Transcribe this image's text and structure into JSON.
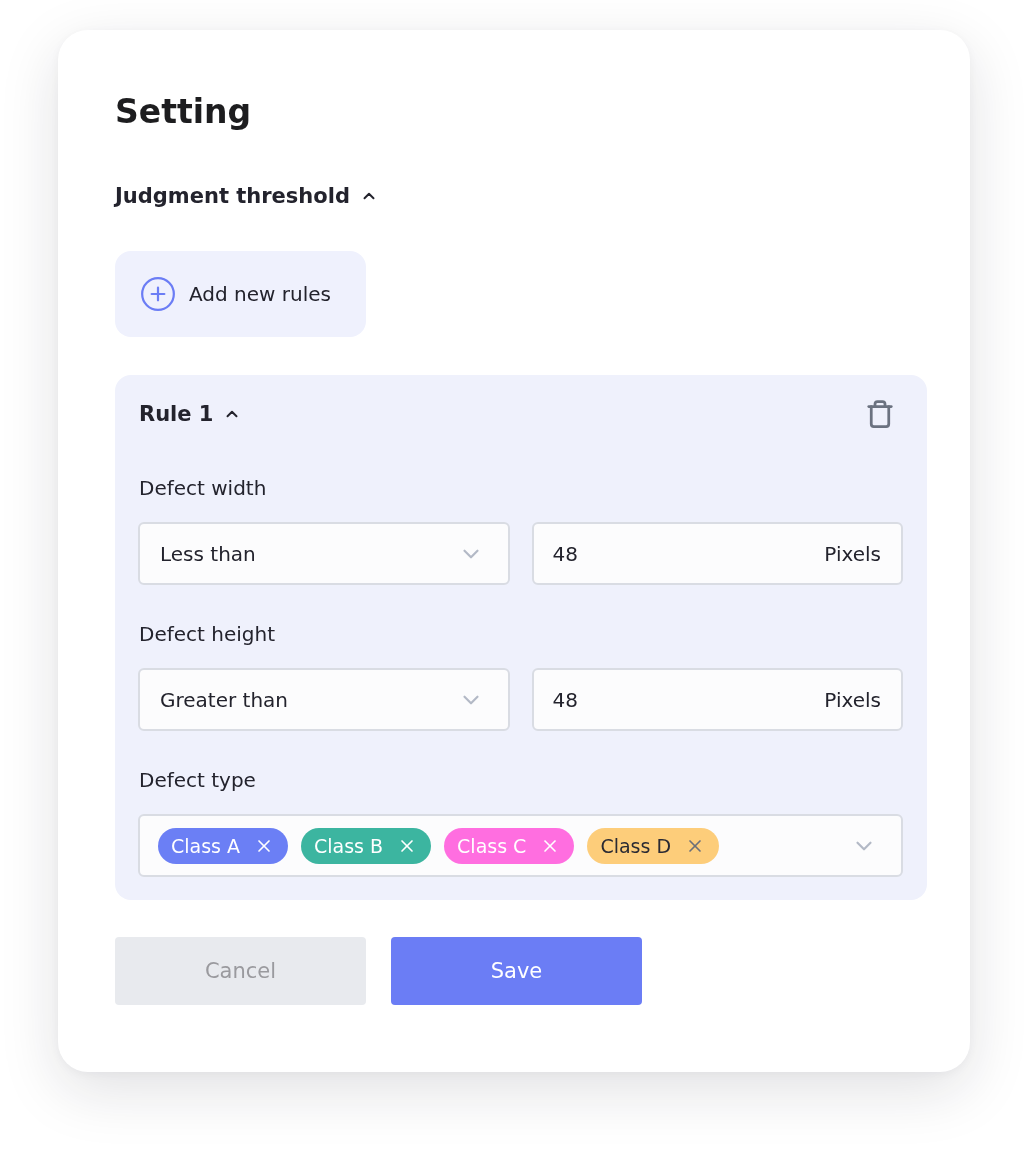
{
  "title": "Setting",
  "section": {
    "title": "Judgment threshold",
    "expanded": true
  },
  "add_button": {
    "label": "Add new rules"
  },
  "rules": [
    {
      "title": "Rule 1",
      "expanded": true,
      "fields": [
        {
          "kind": "range",
          "label": "Defect width",
          "comparison": "Less than",
          "value": "48",
          "unit": "Pixels"
        },
        {
          "kind": "range",
          "label": "Defect height",
          "comparison": "Greater than",
          "value": "48",
          "unit": "Pixels"
        },
        {
          "kind": "tags",
          "label": "Defect type",
          "tags": [
            {
              "label": "Class A",
              "color": "#6b7ff5"
            },
            {
              "label": "Class B",
              "color": "#3cb5a0"
            },
            {
              "label": "Class C",
              "color": "#ff6ee0"
            },
            {
              "label": "Class D",
              "color": "#fdcd7a"
            }
          ]
        }
      ]
    }
  ],
  "buttons": [
    {
      "kind": "secondary",
      "label": "Cancel"
    },
    {
      "kind": "primary",
      "label": "Save"
    }
  ]
}
